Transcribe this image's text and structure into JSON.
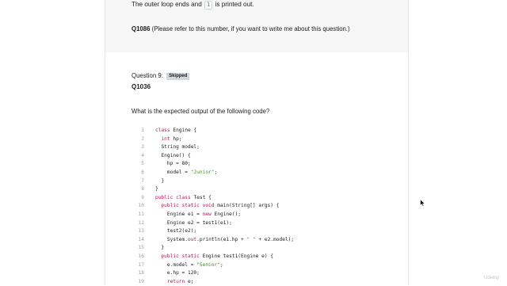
{
  "explanation": {
    "prefix": "The outer loop ends and",
    "code_value": "1",
    "suffix": "is printed out."
  },
  "question_note": {
    "id": "Q1086",
    "text": "(Please refer to this number, if you want to write me about this question.)"
  },
  "question": {
    "label": "Question 9:",
    "status_badge": "Skipped",
    "id": "Q1036",
    "prompt": "What is the expected output of the following code?"
  },
  "code_lines": [
    {
      "n": "1",
      "tokens": [
        {
          "t": "class ",
          "c": "kw"
        },
        {
          "t": "Engine {",
          "c": ""
        }
      ]
    },
    {
      "n": "2",
      "tokens": [
        {
          "t": "  ",
          "c": ""
        },
        {
          "t": "int ",
          "c": "kw"
        },
        {
          "t": "hp;",
          "c": ""
        }
      ]
    },
    {
      "n": "3",
      "tokens": [
        {
          "t": "  String model;",
          "c": ""
        }
      ]
    },
    {
      "n": "4",
      "tokens": [
        {
          "t": "  Engine() {",
          "c": ""
        }
      ]
    },
    {
      "n": "5",
      "tokens": [
        {
          "t": "    hp = 80;",
          "c": ""
        }
      ]
    },
    {
      "n": "6",
      "tokens": [
        {
          "t": "    model = ",
          "c": ""
        },
        {
          "t": "\"Junior\"",
          "c": "st"
        },
        {
          "t": ";",
          "c": ""
        }
      ]
    },
    {
      "n": "7",
      "tokens": [
        {
          "t": "  }",
          "c": ""
        }
      ]
    },
    {
      "n": "8",
      "tokens": [
        {
          "t": "}",
          "c": ""
        }
      ]
    },
    {
      "n": "9",
      "tokens": [
        {
          "t": "public class ",
          "c": "kw"
        },
        {
          "t": "Test {",
          "c": ""
        }
      ]
    },
    {
      "n": "10",
      "tokens": [
        {
          "t": "  ",
          "c": ""
        },
        {
          "t": "public static void ",
          "c": "kw"
        },
        {
          "t": "main(String[] args) {",
          "c": ""
        }
      ]
    },
    {
      "n": "11",
      "tokens": [
        {
          "t": "    Engine e1 = ",
          "c": ""
        },
        {
          "t": "new ",
          "c": "kw"
        },
        {
          "t": "Engine();",
          "c": ""
        }
      ]
    },
    {
      "n": "12",
      "tokens": [
        {
          "t": "    Engine e2 = test1(e1);",
          "c": ""
        }
      ]
    },
    {
      "n": "13",
      "tokens": [
        {
          "t": "    test2(e2);",
          "c": ""
        }
      ]
    },
    {
      "n": "14",
      "tokens": [
        {
          "t": "    System.",
          "c": ""
        },
        {
          "t": "out",
          "c": "kw"
        },
        {
          "t": ".println(e1.hp + ",
          "c": ""
        },
        {
          "t": "\" \"",
          "c": "st"
        },
        {
          "t": " + e2.model);",
          "c": ""
        }
      ]
    },
    {
      "n": "15",
      "tokens": [
        {
          "t": "  }",
          "c": ""
        }
      ]
    },
    {
      "n": "16",
      "tokens": [
        {
          "t": "  ",
          "c": ""
        },
        {
          "t": "public static ",
          "c": "kw"
        },
        {
          "t": "Engine test1(Engine e) {",
          "c": ""
        }
      ]
    },
    {
      "n": "17",
      "tokens": [
        {
          "t": "    e.model = ",
          "c": ""
        },
        {
          "t": "\"Senior\"",
          "c": "st"
        },
        {
          "t": ";",
          "c": ""
        }
      ]
    },
    {
      "n": "18",
      "tokens": [
        {
          "t": "    e.hp = 120;",
          "c": ""
        }
      ]
    },
    {
      "n": "19",
      "tokens": [
        {
          "t": "    ",
          "c": ""
        },
        {
          "t": "return ",
          "c": "kw"
        },
        {
          "t": "e;",
          "c": ""
        }
      ]
    }
  ],
  "watermark": "Udemy"
}
